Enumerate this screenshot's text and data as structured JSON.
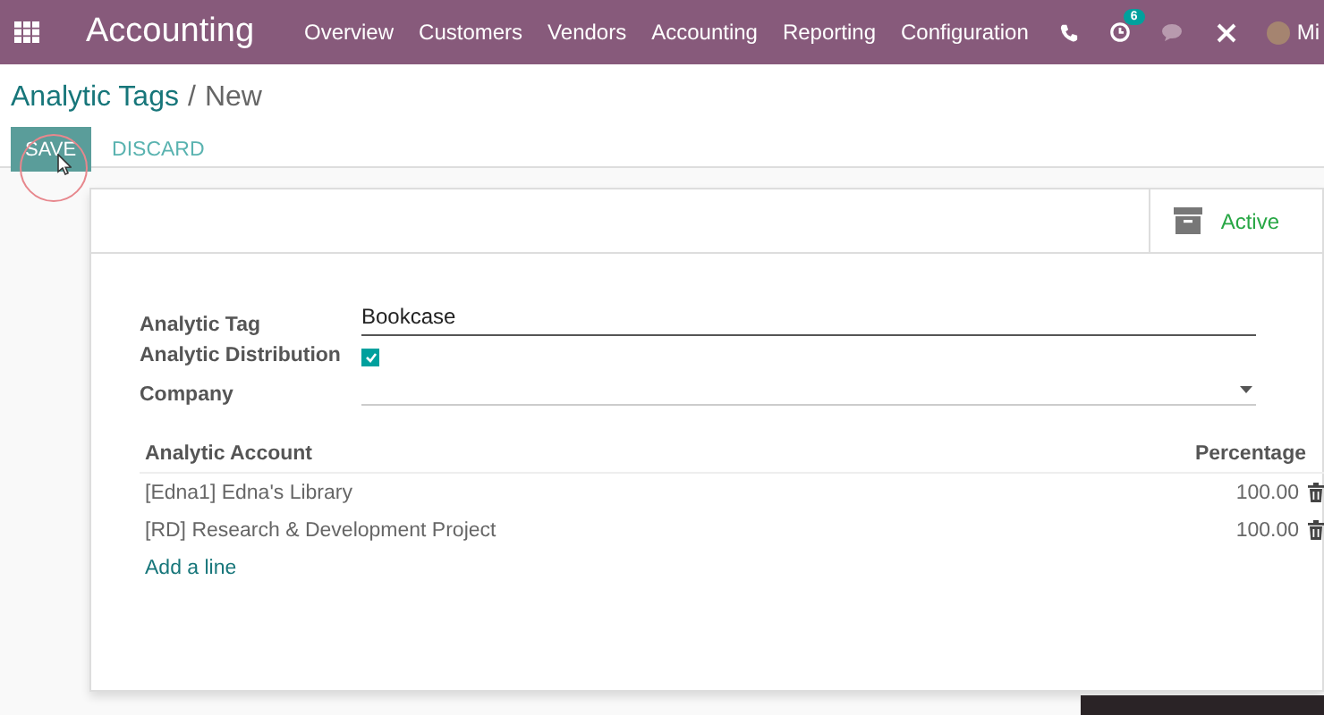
{
  "navbar": {
    "app_title": "Accounting",
    "menu": [
      "Overview",
      "Customers",
      "Vendors",
      "Accounting",
      "Reporting",
      "Configuration"
    ],
    "activity_count": "6",
    "user_name": "Mi"
  },
  "breadcrumb": {
    "parent": "Analytic Tags",
    "separator": "/",
    "current": "New"
  },
  "buttons": {
    "save": "SAVE",
    "discard": "DISCARD"
  },
  "status": {
    "label": "Active",
    "on": true
  },
  "fields": [
    {
      "kind": "text",
      "label": "Analytic Tag",
      "value": "Bookcase"
    },
    {
      "kind": "checkbox",
      "label": "Analytic Distribution",
      "checked": true
    },
    {
      "kind": "select",
      "label": "Company"
    }
  ],
  "table": {
    "columns": [
      "Analytic Account",
      "Percentage"
    ],
    "rows": [
      {
        "account": "[Edna1] Edna's Library",
        "percentage": "100.00"
      },
      {
        "account": "[RD] Research & Development Project",
        "percentage": "100.00"
      }
    ],
    "add_line": "Add a line"
  }
}
